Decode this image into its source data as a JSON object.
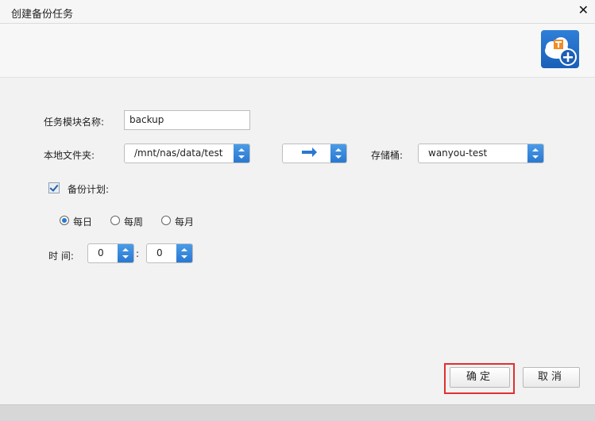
{
  "window": {
    "title": "创建备份任务"
  },
  "form": {
    "task_name_label": "任务模块名称:",
    "task_name_value": "backup",
    "local_folder_label": "本地文件夹:",
    "local_folder_value": "/mnt/nas/data/test",
    "bucket_label": "存储桶:",
    "bucket_value": "wanyou-test",
    "backup_plan_label": "备份计划:",
    "backup_plan_checked": true,
    "schedule_options": [
      {
        "label": "每日",
        "selected": true
      },
      {
        "label": "每周",
        "selected": false
      },
      {
        "label": "每月",
        "selected": false
      }
    ],
    "time_label": "时 间:",
    "hour_value": "0",
    "time_separator": ":",
    "minute_value": "0"
  },
  "buttons": {
    "confirm": "确定",
    "cancel": "取消"
  },
  "colors": {
    "accent": "#2a78d0",
    "highlight_border": "#e03030"
  }
}
